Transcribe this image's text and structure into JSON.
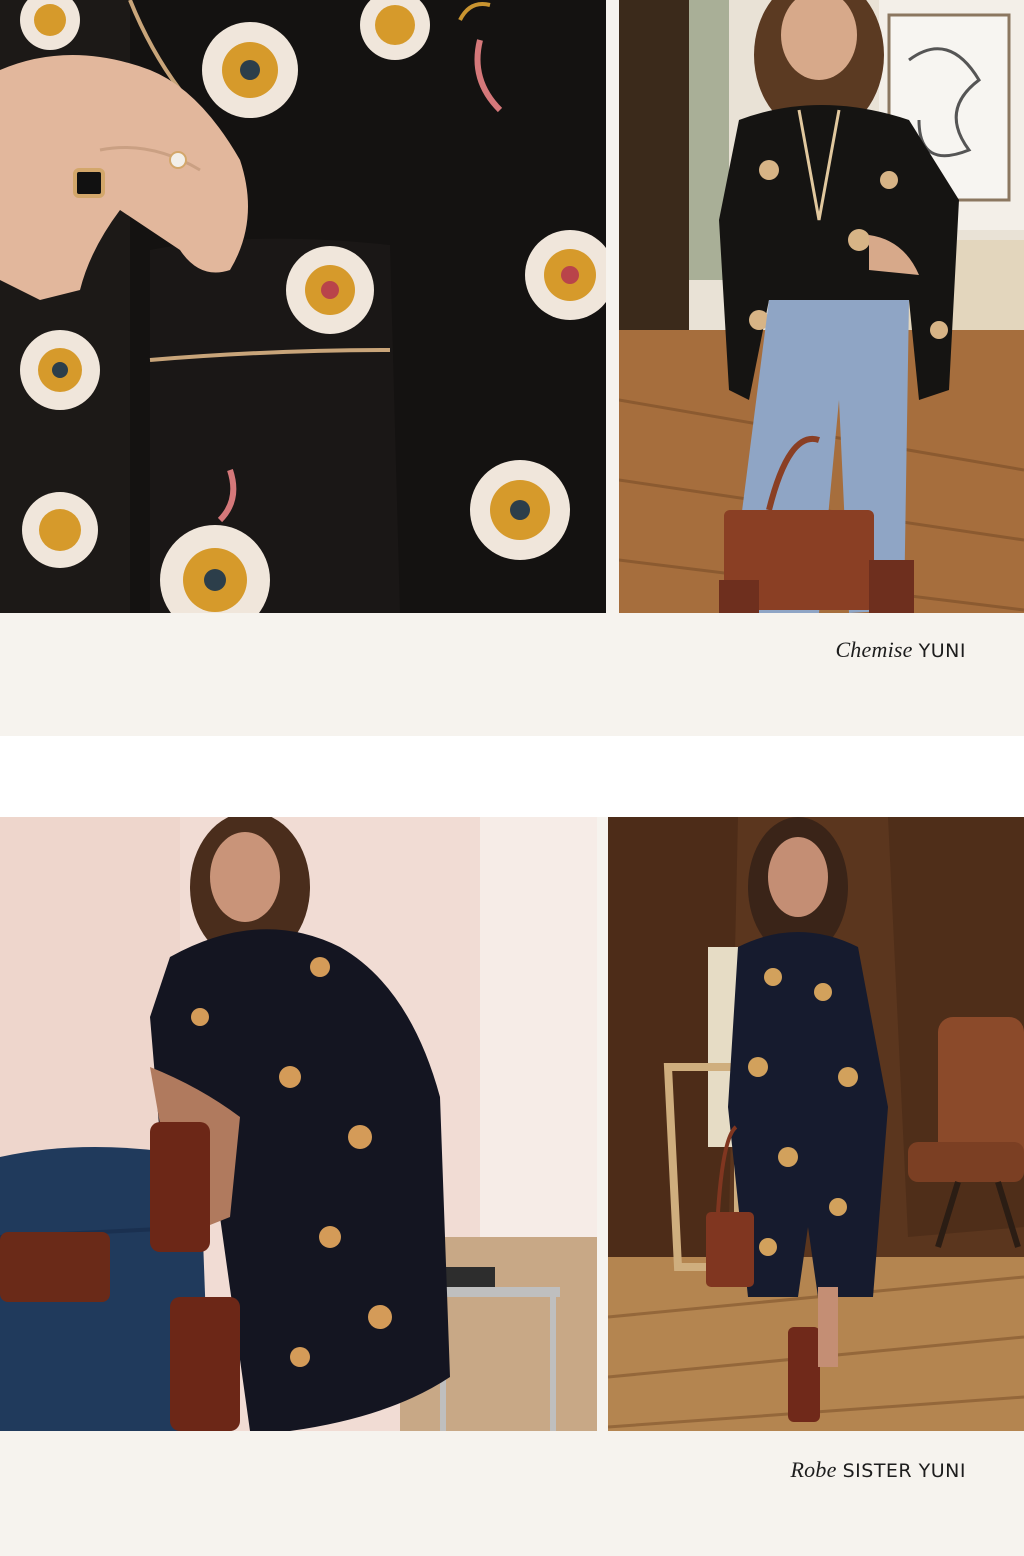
{
  "sections": [
    {
      "caption": {
        "type": "Chemise",
        "name": "YUNI"
      },
      "photos": [
        {
          "icon": "floral-blouse-closeup-photo"
        },
        {
          "icon": "woman-blouse-jeans-photo"
        }
      ]
    },
    {
      "caption": {
        "type": "Robe",
        "name": "SISTER YUNI"
      },
      "photos": [
        {
          "icon": "woman-seated-dress-photo"
        },
        {
          "icon": "woman-standing-dress-photo"
        }
      ]
    }
  ],
  "colors": {
    "band_background": "#f6f3ee",
    "caption_text": "#1d1d1d"
  }
}
